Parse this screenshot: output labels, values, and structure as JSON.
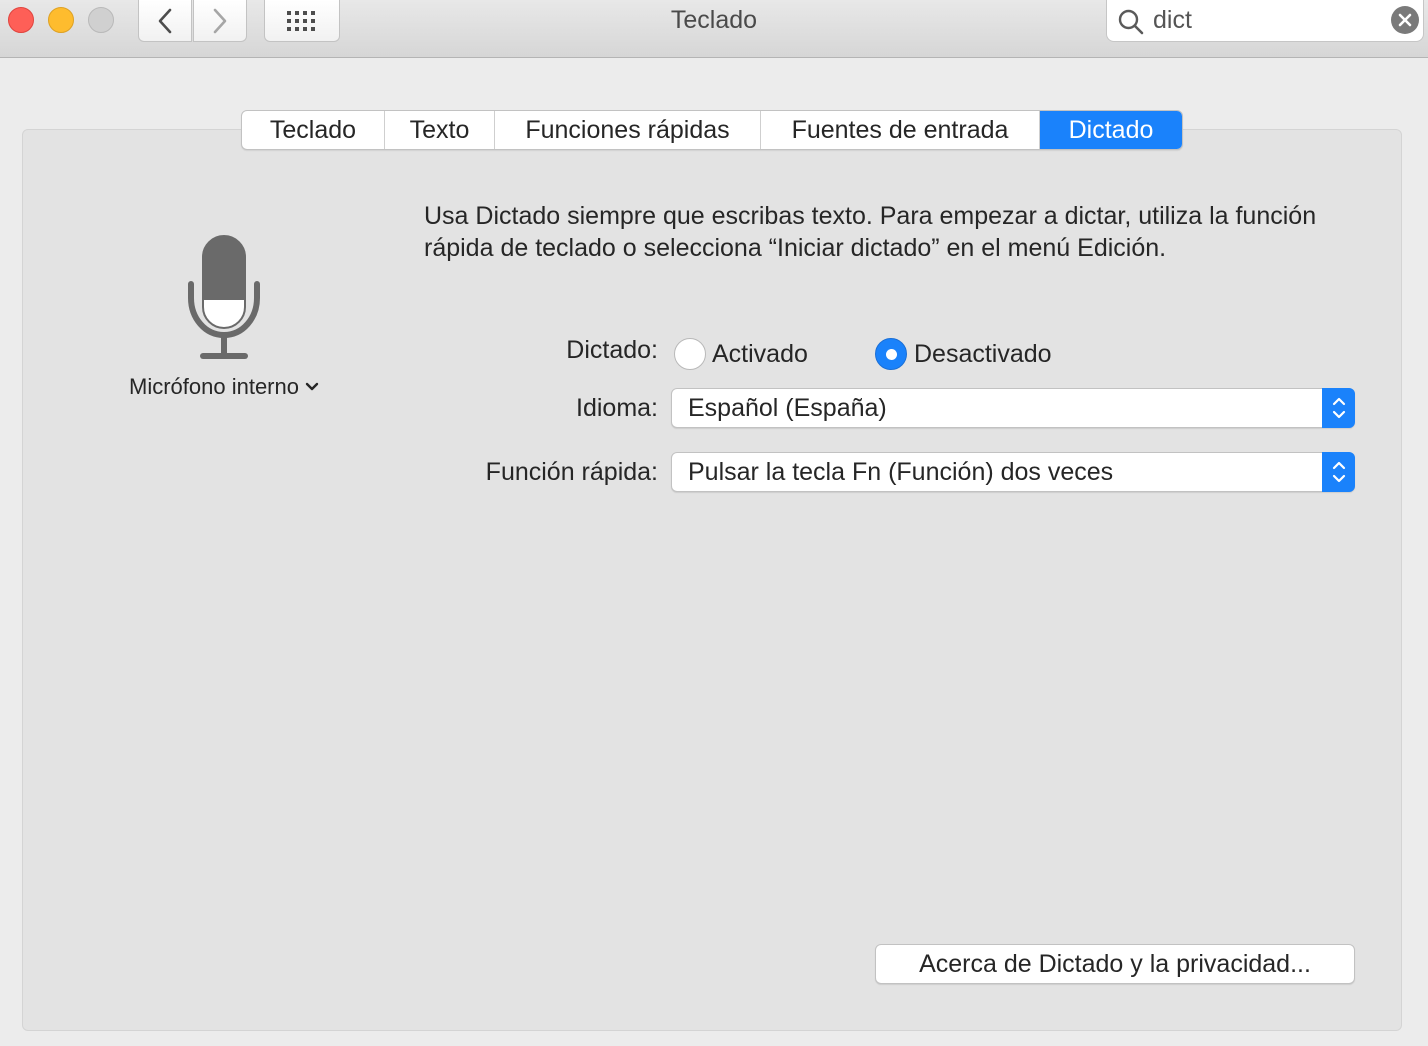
{
  "window": {
    "title": "Teclado"
  },
  "search": {
    "value": "dict"
  },
  "tabs": [
    {
      "label": "Teclado",
      "active": false
    },
    {
      "label": "Texto",
      "active": false
    },
    {
      "label": "Funciones rápidas",
      "active": false
    },
    {
      "label": "Fuentes de entrada",
      "active": false
    },
    {
      "label": "Dictado",
      "active": true
    }
  ],
  "microphone": {
    "icon": "microphone-icon",
    "source_label": "Micrófono interno"
  },
  "dictation": {
    "description": "Usa Dictado siempre que escribas texto. Para empezar a dictar, utiliza la función rápida de teclado o selecciona “Iniciar dictado” en el menú Edición.",
    "dictation_label": "Dictado:",
    "option_on": "Activado",
    "option_off": "Desactivado",
    "selected": "Desactivado",
    "language_label": "Idioma:",
    "language_value": "Español (España)",
    "shortcut_label": "Función rápida:",
    "shortcut_value": "Pulsar la tecla Fn (Función) dos veces",
    "about_button": "Acerca de Dictado y la privacidad..."
  },
  "colors": {
    "accent": "#1a82fb",
    "close": "#fe5f57",
    "minimize": "#febc2e",
    "zoom_disabled": "#d0d0d0"
  }
}
